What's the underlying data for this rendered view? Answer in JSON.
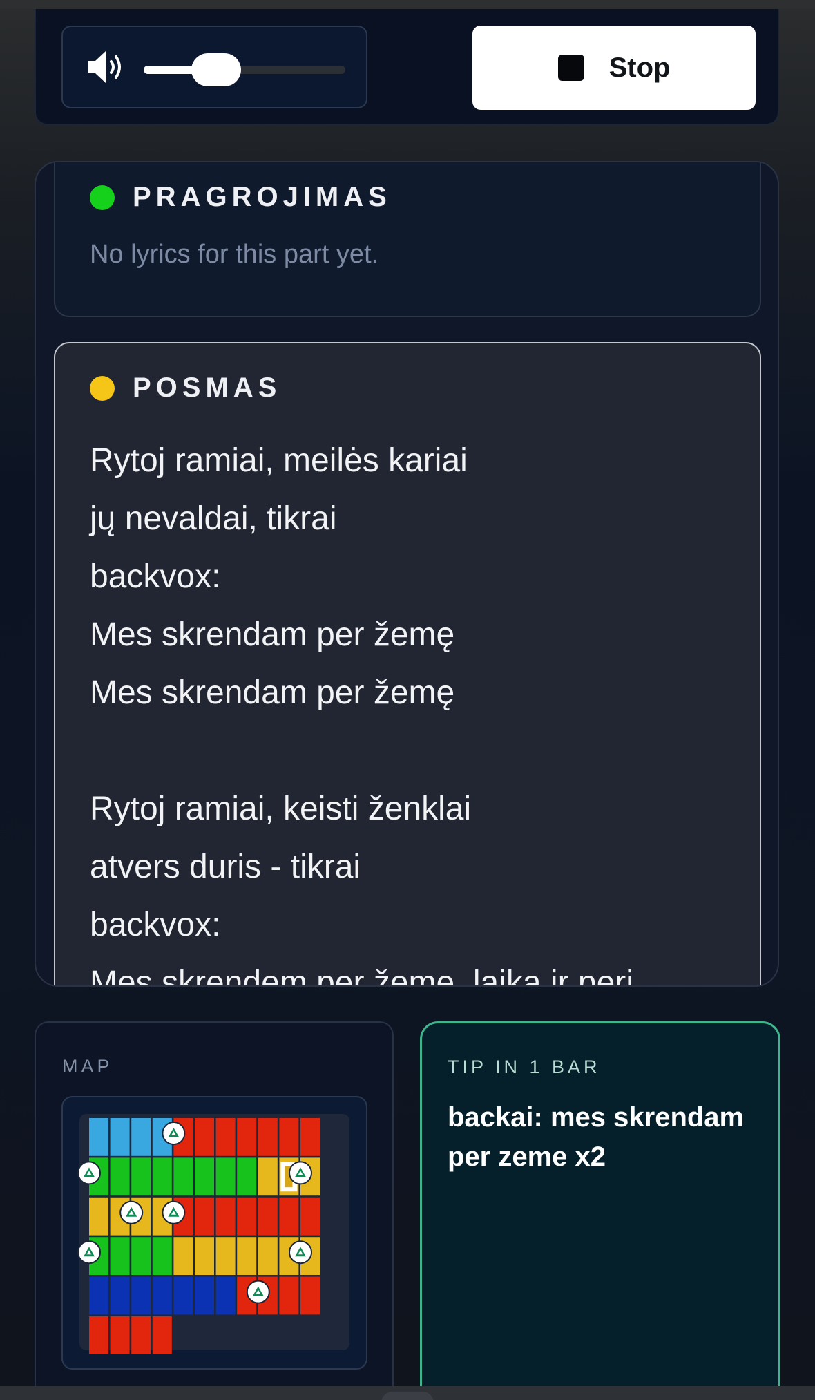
{
  "controls": {
    "volume": 0.36,
    "stop_label": "Stop"
  },
  "lyrics": {
    "sections": [
      {
        "title": "PRAGROJIMAS",
        "dot_color": "#16d11c",
        "empty_text": "No lyrics for this part yet."
      },
      {
        "title": "POSMAS",
        "dot_color": "#f5c518",
        "lines": [
          "Rytoj ramiai, meilės kariai",
          "jų nevaldai, tikrai",
          "backvox:",
          "Mes skrendam per žemę",
          "Mes skrendam per žemę",
          "",
          "Rytoj ramiai, keisti ženklai",
          "atvers duris - tikrai",
          "backvox:",
          "Mes skrendem per žeme, laika ir peri"
        ]
      }
    ]
  },
  "map": {
    "label": "MAP",
    "colors": {
      "B": "#3aa8e0",
      "R": "#e2260d",
      "G": "#16c21b",
      "Y": "#e6b81e",
      "N": "#0b32b3"
    },
    "rows": [
      "BBBBRRRRRRR",
      "GGGGGGGGYYY",
      "YYYYRRRRRRR",
      "GGGGYYYYYYY",
      "NNNNNNNRRRR",
      "RRRR"
    ],
    "markers": [
      {
        "row": 0,
        "col": 4
      },
      {
        "row": 1,
        "col": 0
      },
      {
        "row": 1,
        "col": 10
      },
      {
        "row": 2,
        "col": 2
      },
      {
        "row": 2,
        "col": 4
      },
      {
        "row": 3,
        "col": 0
      },
      {
        "row": 3,
        "col": 10
      },
      {
        "row": 4,
        "col": 8
      }
    ],
    "current": {
      "row": 1,
      "col": 9
    }
  },
  "tip": {
    "label": "TIP IN 1 BAR",
    "text": "backai: mes skrendam per zeme x2"
  }
}
